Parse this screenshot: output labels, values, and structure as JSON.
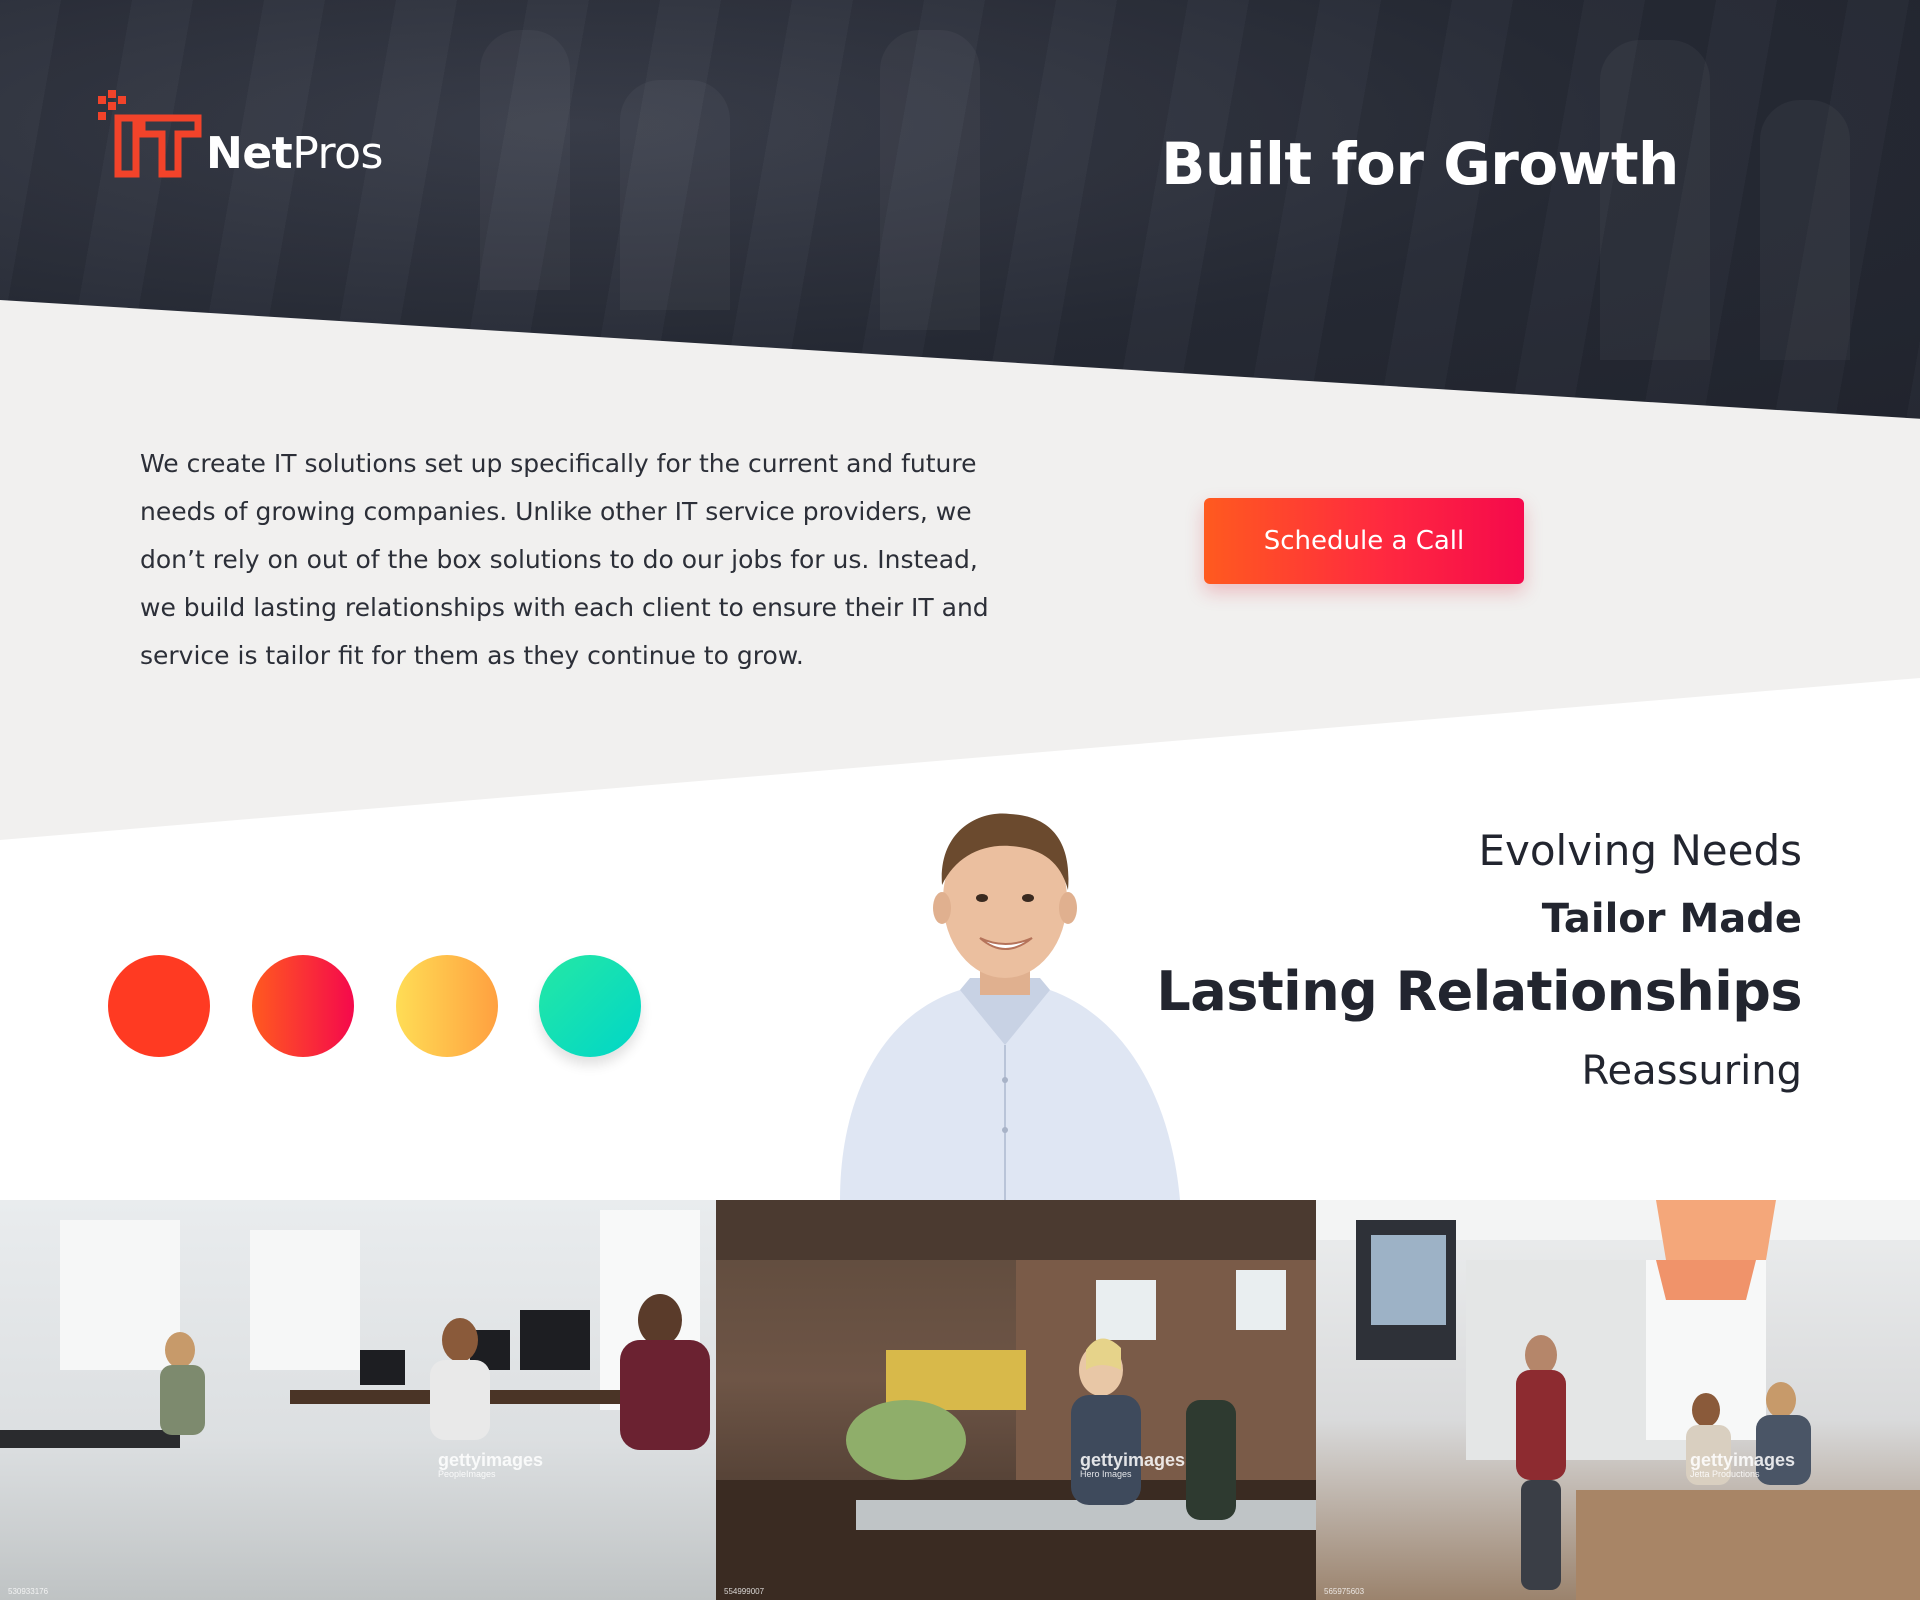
{
  "brand": {
    "logo_mark_letters": "IT",
    "name_bold": "Net",
    "name_light": "Pros"
  },
  "hero": {
    "title": "Built for Growth"
  },
  "intro": {
    "paragraph": "We create IT solutions set up specifically for the current and future needs of growing companies. Unlike other IT service providers, we don’t rely on out of the box solutions to do our jobs for us. Instead, we build lasting relationships with each client to ensure their IT and service is tailor fit for them as they continue to grow."
  },
  "cta": {
    "label": "Schedule a Call"
  },
  "palette": {
    "colors": [
      "#ff3a22",
      "#ff5a1f-#f5094c",
      "#ffdd55-#ffa040",
      "#25e8a4-#00d6c8"
    ]
  },
  "typography": {
    "samples": [
      "Evolving Needs",
      "Tailor Made",
      "Lasting Relationships",
      "Reassuring"
    ]
  },
  "photos": [
    {
      "brand": "gettyimages",
      "credit": "PeopleImages",
      "id": "530933176"
    },
    {
      "brand": "gettyimages",
      "credit": "Hero Images",
      "id": "554999007"
    },
    {
      "brand": "gettyimages",
      "credit": "Jetta Productions",
      "id": "565975603"
    }
  ],
  "colors": {
    "dark": "#262a35",
    "grey_band": "#f1f0ef",
    "accent_orange": "#ff5a1f",
    "accent_red": "#f5094c",
    "text": "#22252f"
  }
}
